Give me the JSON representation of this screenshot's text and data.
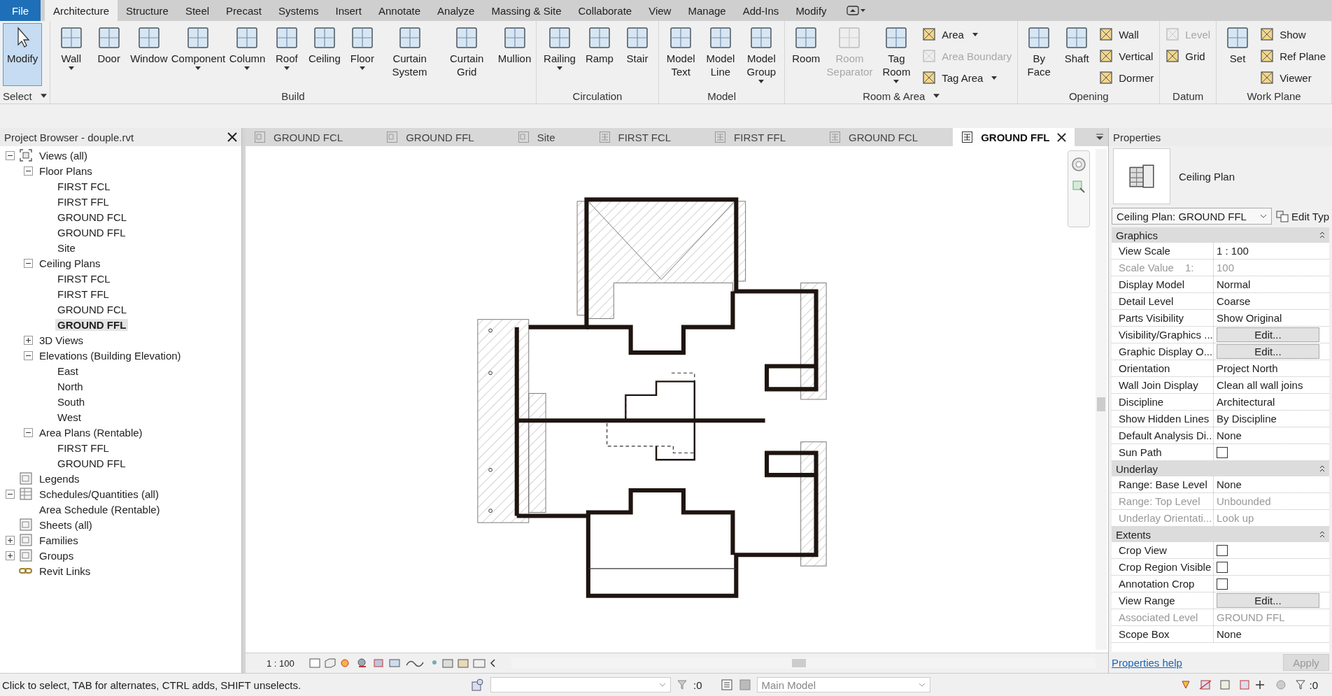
{
  "file_button": "File",
  "menu_tabs": [
    {
      "label": "Architecture",
      "selected": true
    },
    {
      "label": "Structure",
      "selected": false
    },
    {
      "label": "Steel",
      "selected": false
    },
    {
      "label": "Precast",
      "selected": false
    },
    {
      "label": "Systems",
      "selected": false
    },
    {
      "label": "Insert",
      "selected": false
    },
    {
      "label": "Annotate",
      "selected": false
    },
    {
      "label": "Analyze",
      "selected": false
    },
    {
      "label": "Massing & Site",
      "selected": false
    },
    {
      "label": "Collaborate",
      "selected": false
    },
    {
      "label": "View",
      "selected": false
    },
    {
      "label": "Manage",
      "selected": false
    },
    {
      "label": "Add-Ins",
      "selected": false
    },
    {
      "label": "Modify",
      "selected": false
    }
  ],
  "ribbon_panels": [
    {
      "title": "Select",
      "dropdown": true,
      "tools": [
        {
          "label": "Modify",
          "kind": "big",
          "active": true,
          "dropdown": false,
          "disabled": false
        }
      ]
    },
    {
      "title": "Build",
      "dropdown": false,
      "tools": [
        {
          "label": "Wall",
          "kind": "big",
          "dropdown": true,
          "disabled": false
        },
        {
          "label": "Door",
          "kind": "big",
          "dropdown": false,
          "disabled": false
        },
        {
          "label": "Window",
          "kind": "big",
          "dropdown": false,
          "disabled": false
        },
        {
          "label": "Component",
          "kind": "big",
          "dropdown": true,
          "disabled": false
        },
        {
          "label": "Column",
          "kind": "big",
          "dropdown": true,
          "disabled": false
        },
        {
          "label": "Roof",
          "kind": "big",
          "dropdown": true,
          "disabled": false
        },
        {
          "label": "Ceiling",
          "kind": "big",
          "dropdown": false,
          "disabled": false
        },
        {
          "label": "Floor",
          "kind": "big",
          "dropdown": true,
          "disabled": false
        },
        {
          "label": "Curtain System",
          "kind": "big",
          "dropdown": false,
          "disabled": false
        },
        {
          "label": "Curtain Grid",
          "kind": "big",
          "dropdown": false,
          "disabled": false
        },
        {
          "label": "Mullion",
          "kind": "big",
          "dropdown": false,
          "disabled": false
        }
      ]
    },
    {
      "title": "Circulation",
      "dropdown": false,
      "tools": [
        {
          "label": "Railing",
          "kind": "big",
          "dropdown": true,
          "disabled": false
        },
        {
          "label": "Ramp",
          "kind": "big",
          "dropdown": false,
          "disabled": false
        },
        {
          "label": "Stair",
          "kind": "big",
          "dropdown": false,
          "disabled": false
        }
      ]
    },
    {
      "title": "Model",
      "dropdown": false,
      "tools": [
        {
          "label": "Model Text",
          "kind": "big",
          "dropdown": false,
          "disabled": false
        },
        {
          "label": "Model Line",
          "kind": "big",
          "dropdown": false,
          "disabled": false
        },
        {
          "label": "Model Group",
          "kind": "big",
          "dropdown": true,
          "disabled": false
        }
      ]
    },
    {
      "title": "Room & Area",
      "dropdown": true,
      "tools": [
        {
          "label": "Room",
          "kind": "big",
          "dropdown": false,
          "disabled": false
        },
        {
          "label": "Room Separator",
          "kind": "big",
          "dropdown": false,
          "disabled": true
        },
        {
          "label": "Tag Room",
          "kind": "big",
          "dropdown": true,
          "disabled": false
        },
        {
          "label": "Area",
          "kind": "small",
          "dropdown": true,
          "disabled": false
        },
        {
          "label": "Area Boundary",
          "kind": "small",
          "dropdown": false,
          "disabled": true
        },
        {
          "label": "Tag Area",
          "kind": "small",
          "dropdown": true,
          "disabled": false
        }
      ]
    },
    {
      "title": "Opening",
      "dropdown": false,
      "tools": [
        {
          "label": "By Face",
          "kind": "big",
          "dropdown": false,
          "disabled": false
        },
        {
          "label": "Shaft",
          "kind": "big",
          "dropdown": false,
          "disabled": false
        },
        {
          "label": "Wall",
          "kind": "small",
          "dropdown": false,
          "disabled": false
        },
        {
          "label": "Vertical",
          "kind": "small",
          "dropdown": false,
          "disabled": false
        },
        {
          "label": "Dormer",
          "kind": "small",
          "dropdown": false,
          "disabled": false
        }
      ]
    },
    {
      "title": "Datum",
      "dropdown": false,
      "tools": [
        {
          "label": "Level",
          "kind": "small",
          "dropdown": false,
          "disabled": true
        },
        {
          "label": "Grid",
          "kind": "small",
          "dropdown": false,
          "disabled": false
        }
      ]
    },
    {
      "title": "Work Plane",
      "dropdown": false,
      "tools": [
        {
          "label": "Set",
          "kind": "big",
          "dropdown": false,
          "disabled": false
        },
        {
          "label": "Show",
          "kind": "small",
          "dropdown": false,
          "disabled": false
        },
        {
          "label": "Ref Plane",
          "kind": "small",
          "dropdown": false,
          "disabled": false
        },
        {
          "label": "Viewer",
          "kind": "small",
          "dropdown": false,
          "disabled": false
        }
      ]
    }
  ],
  "project_browser": {
    "title": "Project Browser - douple.rvt",
    "tree": [
      {
        "label": "Views (all)",
        "kind": "views",
        "expanded": true,
        "children": [
          {
            "label": "Floor Plans",
            "expanded": true,
            "children": [
              {
                "label": "FIRST FCL",
                "selected": false
              },
              {
                "label": "FIRST FFL",
                "selected": false
              },
              {
                "label": "GROUND FCL",
                "selected": false
              },
              {
                "label": "GROUND FFL",
                "selected": false
              },
              {
                "label": "Site",
                "selected": false
              }
            ]
          },
          {
            "label": "Ceiling Plans",
            "expanded": true,
            "children": [
              {
                "label": "FIRST FCL",
                "selected": false
              },
              {
                "label": "FIRST FFL",
                "selected": false
              },
              {
                "label": "GROUND FCL",
                "selected": false
              },
              {
                "label": "GROUND FFL",
                "selected": true
              }
            ]
          },
          {
            "label": "3D Views",
            "expanded": false
          },
          {
            "label": "Elevations (Building Elevation)",
            "expanded": true,
            "children": [
              {
                "label": "East",
                "selected": false
              },
              {
                "label": "North",
                "selected": false
              },
              {
                "label": "South",
                "selected": false
              },
              {
                "label": "West",
                "selected": false
              }
            ]
          },
          {
            "label": "Area Plans (Rentable)",
            "expanded": true,
            "children": [
              {
                "label": "FIRST FFL",
                "selected": false
              },
              {
                "label": "GROUND FFL",
                "selected": false
              }
            ]
          }
        ]
      },
      {
        "label": "Legends",
        "kind": "legends"
      },
      {
        "label": "Schedules/Quantities (all)",
        "kind": "schedules",
        "expanded": true,
        "children": [
          {
            "label": "Area Schedule (Rentable)",
            "selected": false
          }
        ]
      },
      {
        "label": "Sheets (all)",
        "kind": "sheets"
      },
      {
        "label": "Families",
        "kind": "families",
        "expanded": false
      },
      {
        "label": "Groups",
        "kind": "groups",
        "expanded": false
      },
      {
        "label": "Revit Links",
        "kind": "links"
      }
    ]
  },
  "view_tabs": [
    {
      "label": "GROUND FCL",
      "kind": "floor",
      "selected": false
    },
    {
      "label": "GROUND FFL",
      "kind": "floor",
      "selected": false
    },
    {
      "label": "Site",
      "kind": "floor",
      "selected": false
    },
    {
      "label": "FIRST FCL",
      "kind": "ceiling",
      "selected": false
    },
    {
      "label": "FIRST FFL",
      "kind": "ceiling",
      "selected": false
    },
    {
      "label": "GROUND FCL",
      "kind": "ceiling",
      "selected": false
    },
    {
      "label": "GROUND FFL",
      "kind": "ceiling",
      "selected": true
    }
  ],
  "view_control_bar": {
    "scale": "1 : 100"
  },
  "properties": {
    "title": "Properties",
    "type_name": "Ceiling Plan",
    "type_selector": "Ceiling Plan: GROUND FFL",
    "edit_type": "Edit Typ",
    "sections": [
      {
        "title": "Graphics",
        "rows": [
          {
            "label": "View Scale",
            "kind": "text",
            "value": "1 : 100",
            "disabled": false
          },
          {
            "label": "Scale Value",
            "suffix": "1:",
            "kind": "text",
            "value": "100",
            "disabled": true
          },
          {
            "label": "Display Model",
            "kind": "text",
            "value": "Normal",
            "disabled": false
          },
          {
            "label": "Detail Level",
            "kind": "text",
            "value": "Coarse",
            "disabled": false
          },
          {
            "label": "Parts Visibility",
            "kind": "text",
            "value": "Show Original",
            "disabled": false
          },
          {
            "label": "Visibility/Graphics ...",
            "kind": "button",
            "value": "Edit...",
            "disabled": false
          },
          {
            "label": "Graphic Display O...",
            "kind": "button",
            "value": "Edit...",
            "disabled": false
          },
          {
            "label": "Orientation",
            "kind": "text",
            "value": "Project North",
            "disabled": false
          },
          {
            "label": "Wall Join Display",
            "kind": "text",
            "value": "Clean all wall joins",
            "disabled": false
          },
          {
            "label": "Discipline",
            "kind": "text",
            "value": "Architectural",
            "disabled": false
          },
          {
            "label": "Show Hidden Lines",
            "kind": "text",
            "value": "By Discipline",
            "disabled": false
          },
          {
            "label": "Default Analysis Di...",
            "kind": "text",
            "value": "None",
            "disabled": false
          },
          {
            "label": "Sun Path",
            "kind": "checkbox",
            "checked": false,
            "disabled": false
          }
        ]
      },
      {
        "title": "Underlay",
        "rows": [
          {
            "label": "Range: Base Level",
            "kind": "text",
            "value": "None",
            "disabled": false
          },
          {
            "label": "Range: Top Level",
            "kind": "text",
            "value": "Unbounded",
            "disabled": true
          },
          {
            "label": "Underlay Orientati...",
            "kind": "text",
            "value": "Look up",
            "disabled": true
          }
        ]
      },
      {
        "title": "Extents",
        "rows": [
          {
            "label": "Crop View",
            "kind": "checkbox",
            "checked": false,
            "disabled": false
          },
          {
            "label": "Crop Region Visible",
            "kind": "checkbox",
            "checked": false,
            "disabled": false
          },
          {
            "label": "Annotation Crop",
            "kind": "checkbox",
            "checked": false,
            "disabled": false
          },
          {
            "label": "View Range",
            "kind": "button",
            "value": "Edit...",
            "disabled": false
          },
          {
            "label": "Associated Level",
            "kind": "text",
            "value": "GROUND FFL",
            "disabled": true
          },
          {
            "label": "Scope Box",
            "kind": "text",
            "value": "None",
            "disabled": false
          }
        ]
      }
    ],
    "help_link": "Properties help",
    "apply_button": "Apply"
  },
  "status_bar": {
    "message": "Click to select, TAB for alternates, CTRL adds, SHIFT unselects.",
    "selection_count": ":0",
    "design_option": "Main Model",
    "filter_count": ":0"
  }
}
